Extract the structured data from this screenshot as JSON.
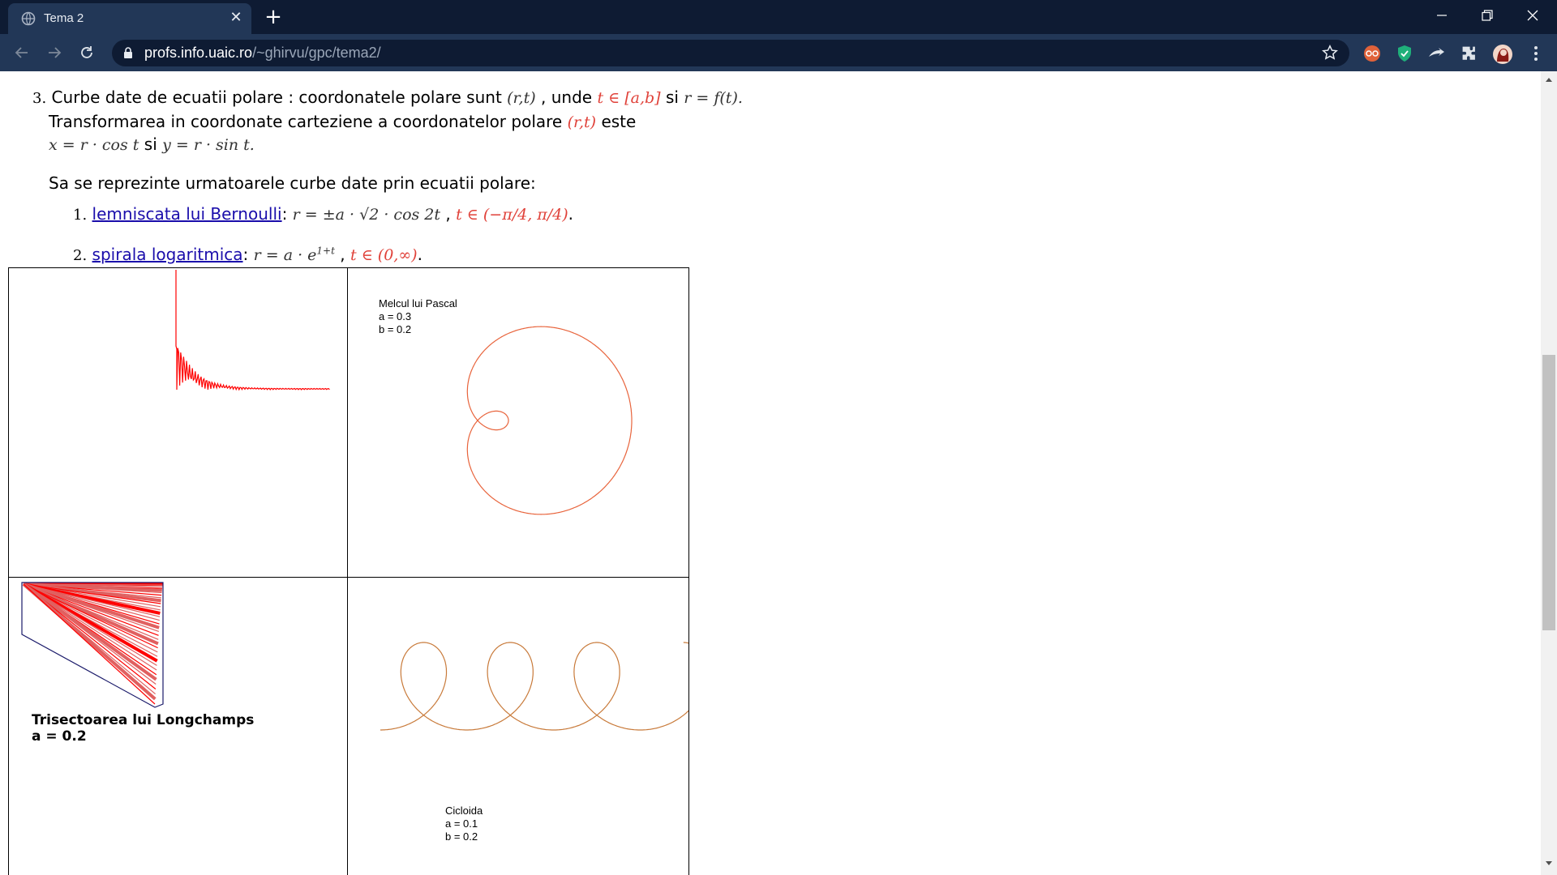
{
  "browser": {
    "tab_title": "Tema 2",
    "url_host": "profs.info.uaic.ro",
    "url_path": "/~ghirvu/gpc/tema2/"
  },
  "item3": {
    "number": "3.",
    "line1_a": "Curbe date de ecuatii polare : coordonatele polare sunt",
    "math_rt": "(r,t)",
    "line1_b": ", unde",
    "math_t_ab": "t ∈ [a,b]",
    "line1_c": "si",
    "math_r_ft": "r = f(t).",
    "line2_a": "Transformarea in coordonate carteziene a coordonatelor polare",
    "math_rt2": "(r,t)",
    "line2_b": "este",
    "math_x": "x = r · cos t",
    "line3_si": "si",
    "math_y": "y = r · sin t.",
    "intro": "Sa se reprezinte urmatoarele curbe date prin ecuatii polare:"
  },
  "subitems": [
    {
      "number": "1.",
      "link": "lemniscata lui Bernoulli",
      "colon": ":",
      "formula": "r = ±a · √2 · cos 2t",
      "sep": ",",
      "domain": "t ∈ (−π/4, π/4)",
      "end": "."
    },
    {
      "number": "2.",
      "link": "spirala logaritmica",
      "colon": ":",
      "formula": "r = a · e",
      "exponent": "1+t",
      "sep": ",",
      "domain": "t ∈ (0,∞)",
      "end": "."
    }
  ],
  "panels": {
    "pascal": {
      "title": "Melcul lui Pascal",
      "a": "a = 0.3",
      "b": "b = 0.2"
    },
    "longchamps": {
      "title": "Trisectoarea lui Longchamps",
      "a": "a = 0.2"
    },
    "cicloida": {
      "title": "Cicloida",
      "a": "a = 0.1",
      "b": "b = 0.2"
    }
  },
  "colors": {
    "tabbar": "#0e1b33",
    "toolbar": "#223757",
    "curve_red": "#ff0000",
    "curve_orange": "#e8643c",
    "curve_brown": "#c87a3a",
    "link": "#1a0dab"
  },
  "icons": [
    "globe-icon",
    "close-icon",
    "plus-icon",
    "minimize-icon",
    "restore-icon",
    "back-icon",
    "forward-icon",
    "reload-icon",
    "lock-icon",
    "star-icon",
    "extension-icon",
    "kebab-icon"
  ]
}
